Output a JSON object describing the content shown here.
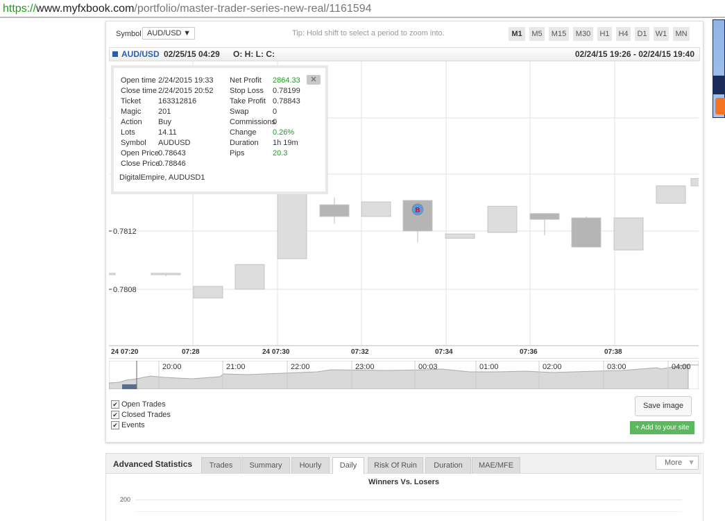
{
  "browser": {
    "url_scheme": "https://",
    "url_domain": "www.myfxbook.com",
    "url_path": "/portfolio/master-trader-series-new-real/1161594"
  },
  "toolbar": {
    "symbol_label": "Symbol",
    "symbol_value": "AUD/USD",
    "tip": "Tip: Hold shift to select a period to zoom into.",
    "timeframes": [
      "M1",
      "M5",
      "M15",
      "M30",
      "H1",
      "H4",
      "D1",
      "W1",
      "MN"
    ],
    "active_timeframe": "M1"
  },
  "chart_header": {
    "symbol": "AUD/USD",
    "datetime": "02/25/15 04:29",
    "ohlc": "O: H: L: C:",
    "range": "02/24/15 19:26 - 02/24/15 19:40"
  },
  "popup": {
    "left": [
      [
        "Open time",
        "2/24/2015 19:33"
      ],
      [
        "Close time",
        "2/24/2015 20:52"
      ],
      [
        "Ticket",
        "163312816"
      ],
      [
        "Magic",
        "201"
      ],
      [
        "Action",
        "Buy"
      ],
      [
        "Lots",
        "14.11"
      ],
      [
        "Symbol",
        "AUDUSD"
      ],
      [
        "Open Price",
        "0.78643"
      ],
      [
        "Close Price",
        "0.78846"
      ]
    ],
    "right": [
      [
        "Net Profit",
        "2864.33",
        true
      ],
      [
        "Stop Loss",
        "0.78199",
        false
      ],
      [
        "Take Profit",
        "0.78843",
        false
      ],
      [
        "Swap",
        "0",
        false
      ],
      [
        "Commissions",
        "0",
        false
      ],
      [
        "Change",
        "0.26%",
        true
      ],
      [
        "Duration",
        "1h 19m",
        false
      ],
      [
        "Pips",
        "20.3",
        true
      ]
    ],
    "footer": "DigitalEmpire, AUDUSD1",
    "close_icon": "close-icon"
  },
  "chart_data": {
    "type": "candlestick",
    "y_ticks": [
      "0.7812",
      "0.7808"
    ],
    "x_ticks": [
      "24 07:20",
      "07:28",
      "24 07:30",
      "07:32",
      "07:34",
      "07:36",
      "07:38"
    ],
    "candles": [
      {
        "o": 0.78091,
        "c": 0.7809,
        "h": 0.78091,
        "l": 0.7809,
        "dir": "up"
      },
      {
        "o": 0.7809,
        "c": 0.78091,
        "h": 0.78091,
        "l": 0.78089,
        "dir": "up"
      },
      {
        "o": 0.78074,
        "c": 0.78082,
        "h": 0.78082,
        "l": 0.78074,
        "dir": "up"
      },
      {
        "o": 0.7808,
        "c": 0.78097,
        "h": 0.78097,
        "l": 0.7808,
        "dir": "up"
      },
      {
        "o": 0.78101,
        "c": 0.7815,
        "h": 0.7815,
        "l": 0.78101,
        "dir": "up"
      },
      {
        "o": 0.78138,
        "c": 0.7813,
        "h": 0.78143,
        "l": 0.78125,
        "dir": "down"
      },
      {
        "o": 0.7813,
        "c": 0.7814,
        "h": 0.7814,
        "l": 0.7813,
        "dir": "up"
      },
      {
        "o": 0.78141,
        "c": 0.7812,
        "h": 0.78141,
        "l": 0.78112,
        "dir": "down",
        "marker": "B"
      },
      {
        "o": 0.78115,
        "c": 0.78118,
        "h": 0.78118,
        "l": 0.78115,
        "dir": "up"
      },
      {
        "o": 0.78119,
        "c": 0.78137,
        "h": 0.78137,
        "l": 0.78119,
        "dir": "up"
      },
      {
        "o": 0.78132,
        "c": 0.78128,
        "h": 0.78132,
        "l": 0.78117,
        "dir": "down"
      },
      {
        "o": 0.78129,
        "c": 0.78109,
        "h": 0.7813,
        "l": 0.78109,
        "dir": "down"
      },
      {
        "o": 0.78107,
        "c": 0.78129,
        "h": 0.78129,
        "l": 0.78107,
        "dir": "up"
      },
      {
        "o": 0.78139,
        "c": 0.78151,
        "h": 0.78151,
        "l": 0.78139,
        "dir": "up"
      },
      {
        "o": 0.78151,
        "c": 0.78156,
        "h": 0.78156,
        "l": 0.78151,
        "dir": "up"
      }
    ],
    "navigator_labels": [
      "20:00",
      "21:00",
      "22:00",
      "23:00",
      "00:03",
      "01:00",
      "02:00",
      "03:00",
      "04:00"
    ]
  },
  "options": {
    "checkboxes": [
      "Open Trades",
      "Closed Trades",
      "Events"
    ],
    "save_image": "Save image",
    "add_to_site": "+ Add to your site"
  },
  "stats": {
    "title": "Advanced Statistics",
    "tabs": [
      "Trades",
      "Summary",
      "Hourly",
      "Daily",
      "Risk Of Ruin",
      "Duration",
      "MAE/MFE"
    ],
    "active_tab": "Daily",
    "more": "More",
    "chart_title": "Winners Vs. Losers",
    "y_tick": "200"
  },
  "colors": {
    "up": "#dddddd",
    "down": "#b5b5b5",
    "marker": "#5b9be0",
    "green": "#5cb85c"
  }
}
